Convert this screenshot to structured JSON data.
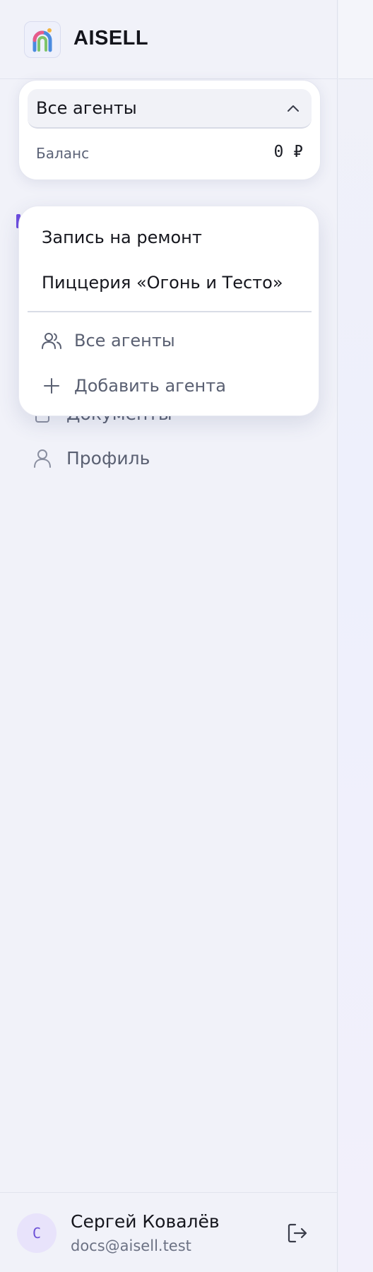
{
  "header": {
    "brand": "AISELL",
    "logo_icon": "rainbow-logo-icon"
  },
  "agent_selector": {
    "selected": "Все агенты",
    "balance_label": "Баланс",
    "balance_value": "0 ₽"
  },
  "dropdown": {
    "agents": [
      "Запись на ремонт",
      "Пиццерия «Огонь и Тесто»"
    ],
    "all_agents_label": "Все агенты",
    "add_agent_label": "Добавить агента"
  },
  "nav": {
    "documents_label": "Документы",
    "profile_label": "Профиль"
  },
  "user": {
    "initial": "С",
    "name": "Сергей Ковалёв",
    "email": "docs@aisell.test"
  },
  "colors": {
    "accent": "#6d4de0",
    "sidebar_bg": "#f1f2f9",
    "text_muted": "#5a6072"
  }
}
